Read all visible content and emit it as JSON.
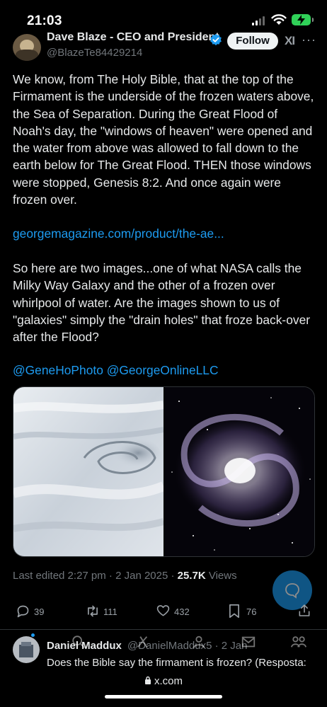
{
  "status_bar": {
    "time": "21:03"
  },
  "tweet": {
    "author_name": "Dave Blaze - CEO and President",
    "handle": "@BlazeTe84429214",
    "follow_label": "Follow",
    "grok_label": "XI",
    "more_label": "···",
    "paragraph_1": "We know, from The Holy Bible, that at the top of the Firmament is the underside of the frozen waters above, the Sea of Separation. During the Great Flood of Noah's day, the \"windows of heaven\" were opened and the water from above was allowed to fall down to the earth below for The Great Flood. THEN those windows were stopped, Genesis 8:2. And once again were frozen over.",
    "link": "georgemagazine.com/product/the-ae...",
    "paragraph_2": "So here are two images...one of what NASA calls the Milky Way Galaxy and the other of a frozen over whirlpool of water. Are the images shown to us of \"galaxies\" simply the \"drain holes\" that froze back-over after the Flood?",
    "mentions": "@GeneHoPhoto @GeorgeOnlineLLC",
    "meta_edited": "Last edited 2:27 pm · 2 Jan 2025 · ",
    "views_count": "25.7K",
    "views_label": " Views",
    "actions": {
      "replies": "39",
      "reposts": "111",
      "likes": "432",
      "bookmarks": "76"
    }
  },
  "reply": {
    "name": "Daniel Maddux",
    "handle": "@DanielMaddux5 · 2 Jan",
    "text": "Does the Bible say the firmament is frozen? (Resposta:"
  },
  "browser": {
    "url": "x.com"
  },
  "colors": {
    "accent": "#1d9bf0",
    "background": "#000000",
    "text": "#e7e9ea",
    "muted": "#71767b",
    "battery": "#30d158"
  },
  "icons": [
    "signal-icon",
    "wifi-icon",
    "battery-icon",
    "verified-badge-icon",
    "grok-icon",
    "more-icon",
    "reply-icon",
    "repost-icon",
    "like-icon",
    "bookmark-icon",
    "share-icon",
    "compose-icon",
    "lock-icon"
  ]
}
